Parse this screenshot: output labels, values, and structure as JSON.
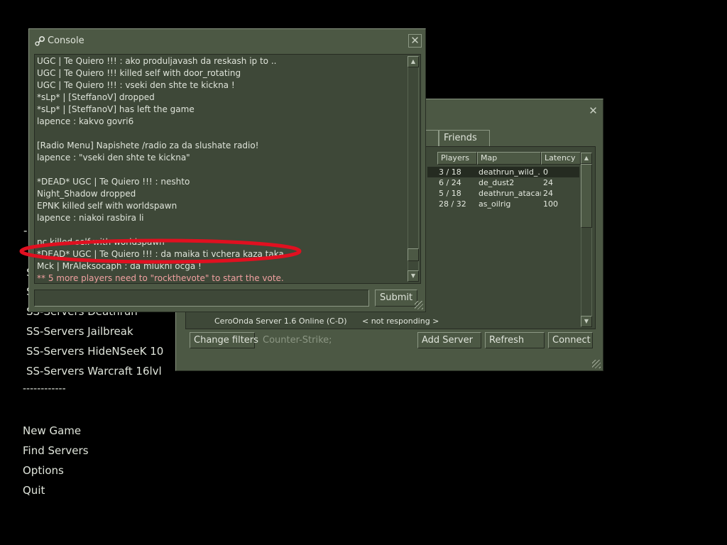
{
  "main_menu": {
    "partial_top": "S",
    "partial_dash": "-",
    "server_items": [
      "SS-Servers Deathrun",
      "SS-Servers Jailbreak",
      "SS-Servers HideNSeeK 10",
      "SS-Servers Warcraft 16lvl"
    ],
    "separator": "------------",
    "bottom_items": [
      "New Game",
      "Find Servers",
      "Options",
      "Quit"
    ]
  },
  "server_browser": {
    "tabs": {
      "friends": "Friends"
    },
    "columns": {
      "players": "Players",
      "map": "Map",
      "latency": "Latency"
    },
    "rows": [
      {
        "players": "3 / 18",
        "map": "deathrun_wild_...",
        "latency": "0"
      },
      {
        "players": "6 / 24",
        "map": "de_dust2",
        "latency": "24"
      },
      {
        "players": "5 / 18",
        "map": "deathrun_atacama",
        "latency": "24"
      },
      {
        "players": "28 / 32",
        "map": "as_oilrig",
        "latency": "100"
      }
    ],
    "partial_rows": [
      {
        "name": "",
        "status": "< not responding >"
      },
      {
        "name": "CeroOnda Server 1.6 Online (C-D)",
        "status": "< not responding >"
      }
    ],
    "buttons": {
      "change_filters": "Change filters",
      "add_server": "Add Server",
      "refresh": "Refresh",
      "connect": "Connect"
    },
    "filter_text": "Counter-Strike;",
    "close_icon": "close-icon"
  },
  "console": {
    "title": "Console",
    "lines": [
      "UGC | Te Quiero !!! :  ako produljavash da reskash ip to ..",
      "UGC | Te Quiero !!! killed self with door_rotating",
      "UGC | Te Quiero !!! :  vseki den shte te kickna !",
      "*sLp* |  [SteffanoV] dropped",
      "*sLp* |  [SteffanoV] has left the game",
      "lapence :  kakvo govri6",
      "",
      "[Radio Menu] Napishete /radio za da slushate radio!",
      "lapence :  \"vseki den shte te kickna\"",
      "",
      "*DEAD* UGC | Te Quiero !!! :  neshto",
      "Night_Shadow dropped",
      "EPNK killed self with worldspawn",
      "lapence :  niakoi rasbira li",
      "",
      "nc killed self with worldspawn",
      "*DEAD* UGC | Te Quiero !!! :  da maika ti vchera kaza taka",
      " Mck | MrAleksocaph :  da mlukni ocga !",
      "** 5 more players need to \"rockthevote\" to start the vote."
    ],
    "input_value": "",
    "submit_label": "Submit",
    "highlight_color": "#e01020"
  }
}
